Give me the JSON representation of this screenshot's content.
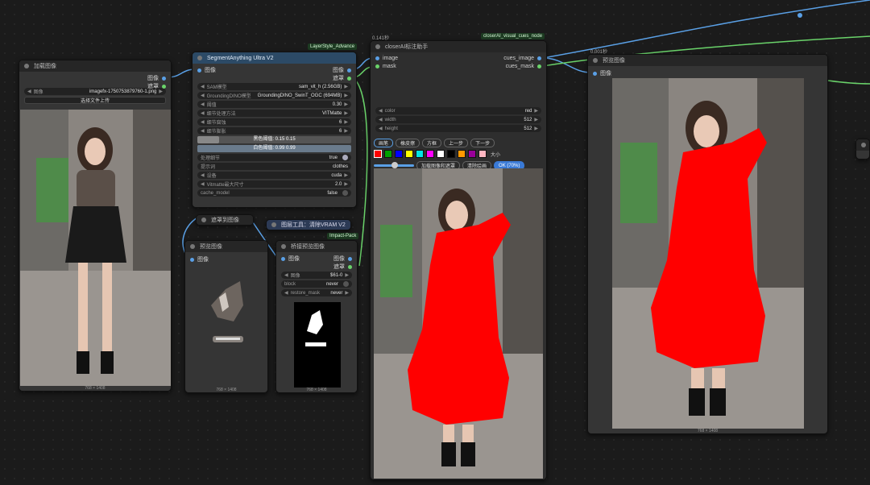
{
  "load_image": {
    "title": "加载图像",
    "out_image": "图像",
    "out_mask": "遮罩",
    "file_label": "图像",
    "file_value": "imagefx-1750753879760-1.png",
    "upload_label": "选择文件上传",
    "dims": "768 × 1408"
  },
  "segment": {
    "category": "LayerStyle_Advance",
    "title": "SegmentAnything Ultra V2",
    "in_image": "图像",
    "out_image": "图像",
    "out_mask": "遮罩",
    "widgets": [
      {
        "label": "SAM模型",
        "value": "sam_vit_h (2.56GB)"
      },
      {
        "label": "GroundingDINO模型",
        "value": "GroundingDINO_SwinT_OGC (694MB)"
      },
      {
        "label": "阈值",
        "value": "0.30"
      },
      {
        "label": "细节处理方法",
        "value": "VITMatte"
      },
      {
        "label": "细节腐蚀",
        "value": "6"
      },
      {
        "label": "细节膨胀",
        "value": "6"
      }
    ],
    "black_slider": "黑色阈值: 0.15  0.15",
    "white_slider": "白色阈值: 0.99  0.99",
    "widgets2": [
      {
        "label": "处理细节",
        "value": "true"
      },
      {
        "label": "提示词",
        "value": "clothes"
      },
      {
        "label": "设备",
        "value": "cuda"
      },
      {
        "label": "Vitmatte最大尺寸",
        "value": "2.0"
      },
      {
        "label": "cache_model",
        "value": "false"
      }
    ]
  },
  "mask_to_image": {
    "title": "遮罩到图像"
  },
  "purge_vram": {
    "title": "图层工具：清除VRAM V2"
  },
  "preview1": {
    "title": "预览图像",
    "in_image": "图像",
    "dims": "768 × 1408"
  },
  "bridge": {
    "category": "Impact-Pack",
    "title": "桥接预览图像",
    "in_image": "图像",
    "out_image": "图像",
    "out_mask": "遮罩",
    "widgets": [
      {
        "label": "图像",
        "value": "$61-0"
      },
      {
        "label": "block",
        "value": "never"
      },
      {
        "label": "restore_mask",
        "value": "never"
      }
    ],
    "dims": "768 × 1408"
  },
  "cues": {
    "time": "0.141秒",
    "category": "closerAI_visual_cues_node",
    "title": "closerAI标注助手",
    "in_image": "image",
    "in_mask": "mask",
    "out_image": "cues_image",
    "out_mask": "cues_mask",
    "widgets": [
      {
        "label": "color",
        "value": "red"
      },
      {
        "label": "width",
        "value": "512"
      },
      {
        "label": "height",
        "value": "512"
      }
    ],
    "tools": [
      "画笔",
      "橡皮擦",
      "方框",
      "上一步",
      "下一步"
    ],
    "colors": [
      "#ff0000",
      "#00a000",
      "#0000ff",
      "#ffff00",
      "#00e5e5",
      "#ff00ff",
      "#ffffff",
      "#000000",
      "#ff9900",
      "#990099",
      "#ffb6c1"
    ],
    "size_label": "大小",
    "load_mask_btn": "加载图像和遮罩",
    "clear_btn": "清除绘画",
    "ok_btn": "OK (70%)"
  },
  "preview2": {
    "time": "0.001秒",
    "title": "预览图像",
    "in_image": "图像",
    "dims": "768 × 1408"
  },
  "colors": {
    "wire_blue": "#5aa0e6",
    "wire_green": "#6ad36a",
    "mask_red": "#ff0000"
  }
}
